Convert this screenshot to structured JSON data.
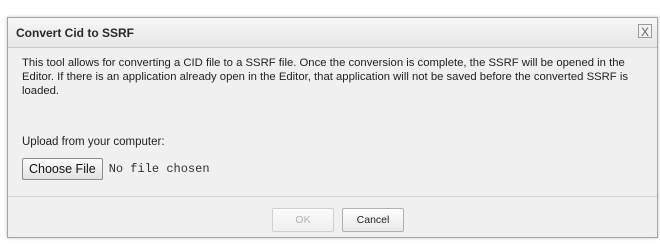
{
  "dialog": {
    "title": "Convert Cid to SSRF",
    "close_label": "X",
    "description": "This tool allows for converting a CID file to a SSRF file. Once the conversion is complete, the SSRF will be opened in the Editor. If there is an application already open in the Editor, that application will not be saved before the converted SSRF is loaded.",
    "upload_label": "Upload from your computer:",
    "choose_file_label": "Choose File",
    "no_file_text": "No file chosen",
    "ok_label": "OK",
    "cancel_label": "Cancel",
    "ok_enabled": false,
    "icons": {
      "close": "close-icon"
    }
  }
}
